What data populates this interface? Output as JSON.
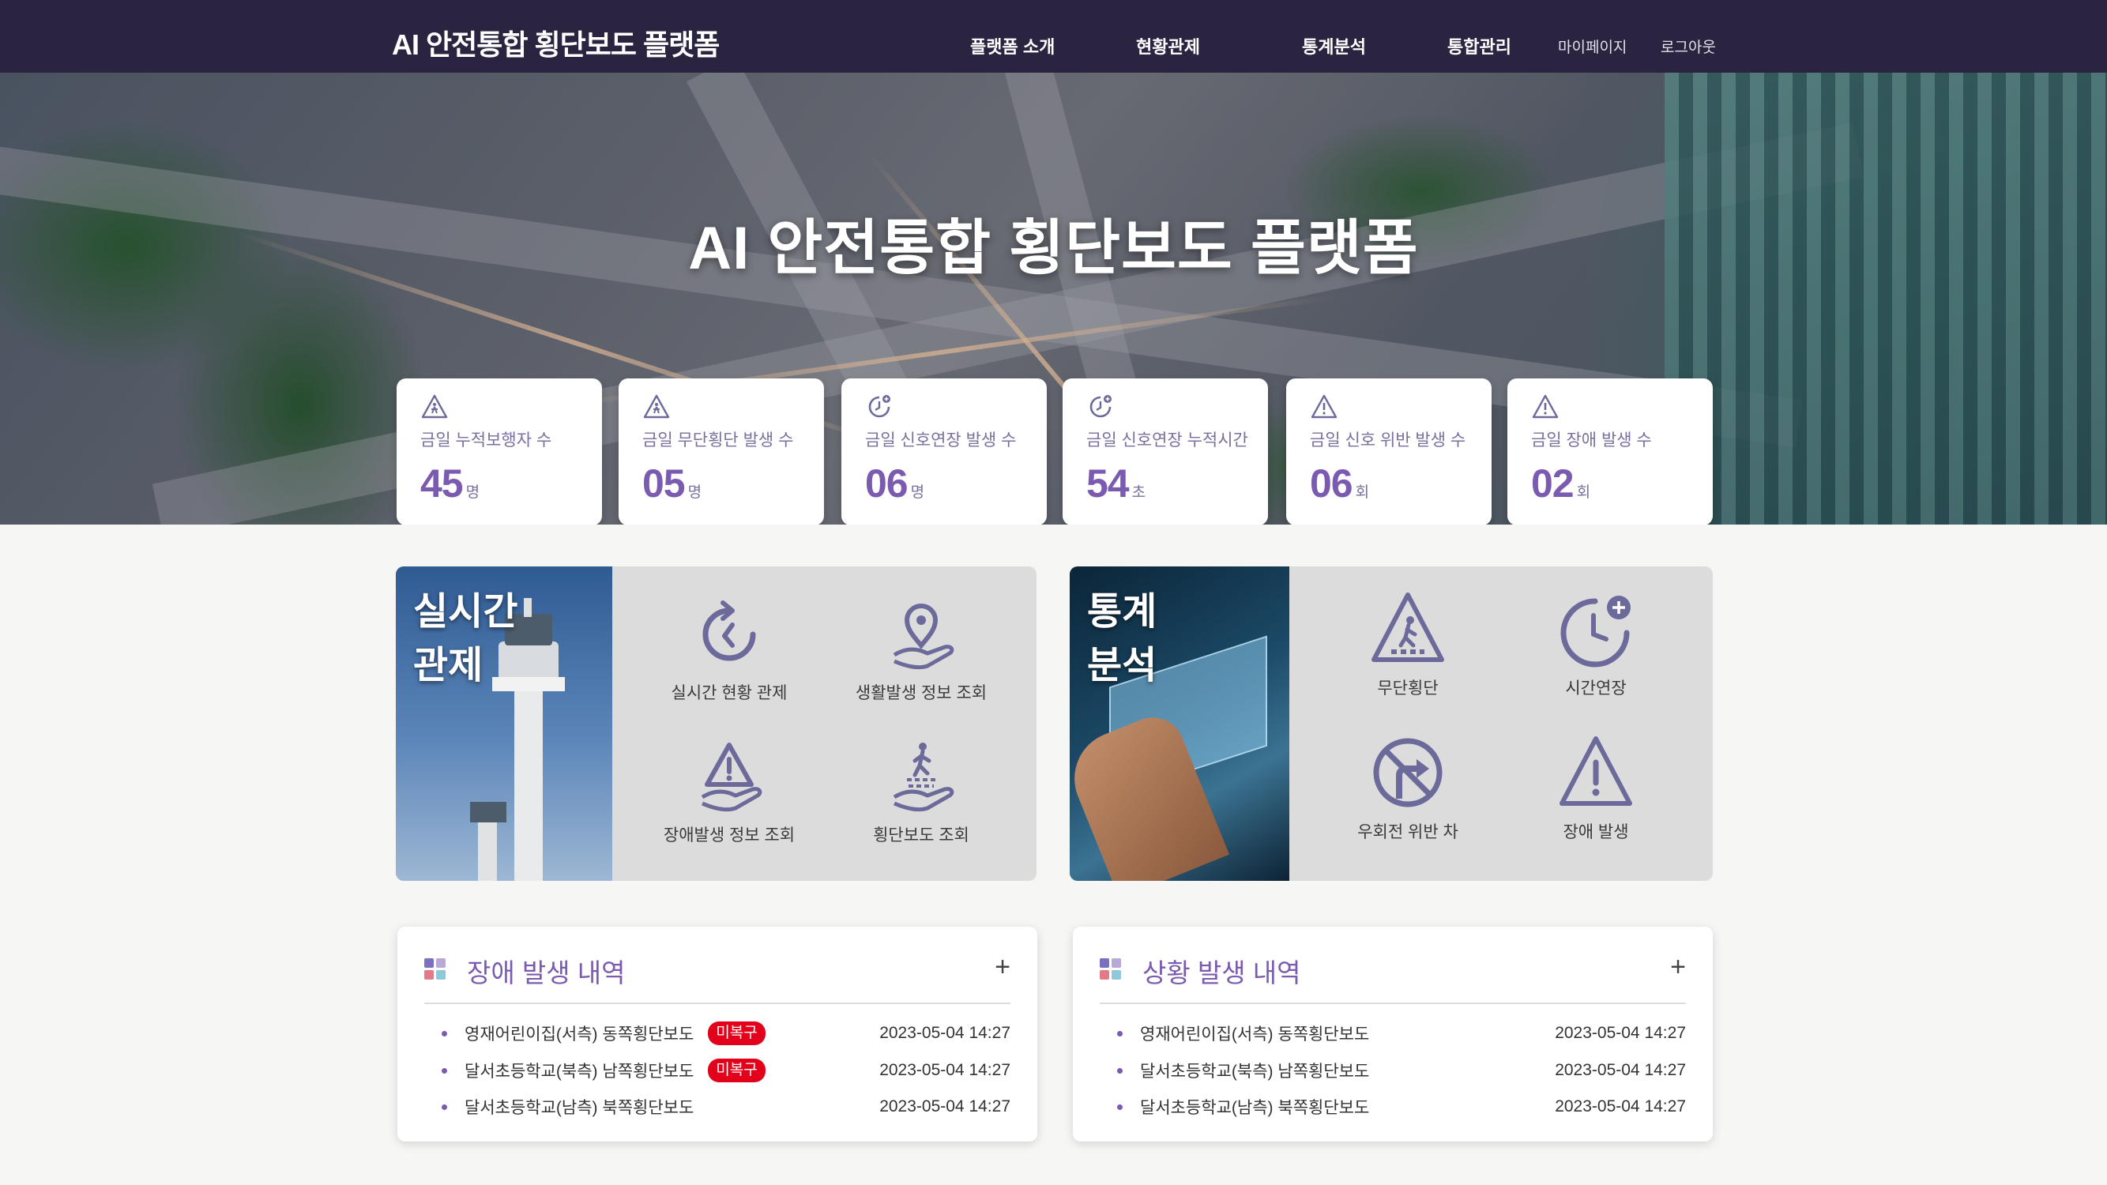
{
  "header": {
    "brand": "AI 안전통합 횡단보도 플랫폼",
    "nav": [
      "플랫폼 소개",
      "현황관제",
      "통계분석",
      "통합관리"
    ],
    "mypage": "마이페이지",
    "logout": "로그아웃"
  },
  "hero": {
    "title": "AI 안전통합 횡단보도 플랫폼",
    "stats": [
      {
        "icon": "pedestrian-warning-icon",
        "label": "금일 누적보행자 수",
        "value": "45",
        "unit": "명"
      },
      {
        "icon": "pedestrian-warning-icon",
        "label": "금일 무단횡단 발생 수",
        "value": "05",
        "unit": "명"
      },
      {
        "icon": "signal-extend-icon",
        "label": "금일 신호연장 발생 수",
        "value": "06",
        "unit": "명"
      },
      {
        "icon": "signal-extend-icon",
        "label": "금일 신호연장 누적시간",
        "value": "54",
        "unit": "초"
      },
      {
        "icon": "warning-icon",
        "label": "금일 신호 위반 발생 수",
        "value": "06",
        "unit": "회"
      },
      {
        "icon": "warning-icon",
        "label": "금일 장애 발생 수",
        "value": "02",
        "unit": "회"
      }
    ]
  },
  "realtime": {
    "title_line1": "실시간",
    "title_line2": "관제",
    "items": [
      {
        "icon": "realtime-monitor-icon",
        "label": "실시간 현황 관제"
      },
      {
        "icon": "location-hand-icon",
        "label": "생활발생 정보 조회"
      },
      {
        "icon": "warning-hand-icon",
        "label": "장애발생 정보 조회"
      },
      {
        "icon": "crosswalk-hand-icon",
        "label": "횡단보도 조회"
      }
    ]
  },
  "statistics": {
    "title_line1": "통계",
    "title_line2": "분석",
    "items": [
      {
        "icon": "jaywalking-icon",
        "label": "무단횡단"
      },
      {
        "icon": "time-extend-icon",
        "label": "시간연장"
      },
      {
        "icon": "no-right-turn-icon",
        "label": "우회전 위반 차"
      },
      {
        "icon": "warning-icon",
        "label": "장애 발생"
      }
    ]
  },
  "fault_list": {
    "title": "장애 발생 내역",
    "more": "+",
    "rows": [
      {
        "name": "영재어린이집(서측) 동쪽횡단보도",
        "badge": "미복구",
        "date": "2023-05-04 14:27"
      },
      {
        "name": "달서초등학교(북측) 남쪽횡단보도",
        "badge": "미복구",
        "date": "2023-05-04 14:27"
      },
      {
        "name": "달서초등학교(남측) 북쪽횡단보도",
        "badge": "",
        "date": "2023-05-04 14:27"
      }
    ]
  },
  "situation_list": {
    "title": "상황 발생 내역",
    "more": "+",
    "rows": [
      {
        "name": "영재어린이집(서측) 동쪽횡단보도",
        "date": "2023-05-04 14:27"
      },
      {
        "name": "달서초등학교(북측) 남쪽횡단보도",
        "date": "2023-05-04 14:27"
      },
      {
        "name": "달서초등학교(남측) 북쪽횡단보도",
        "date": "2023-05-04 14:27"
      }
    ]
  },
  "colors": {
    "accent": "#7a5bb0",
    "header_bg": "#2b2440",
    "badge": "#e2001a",
    "icon": "#6c6a9a"
  }
}
